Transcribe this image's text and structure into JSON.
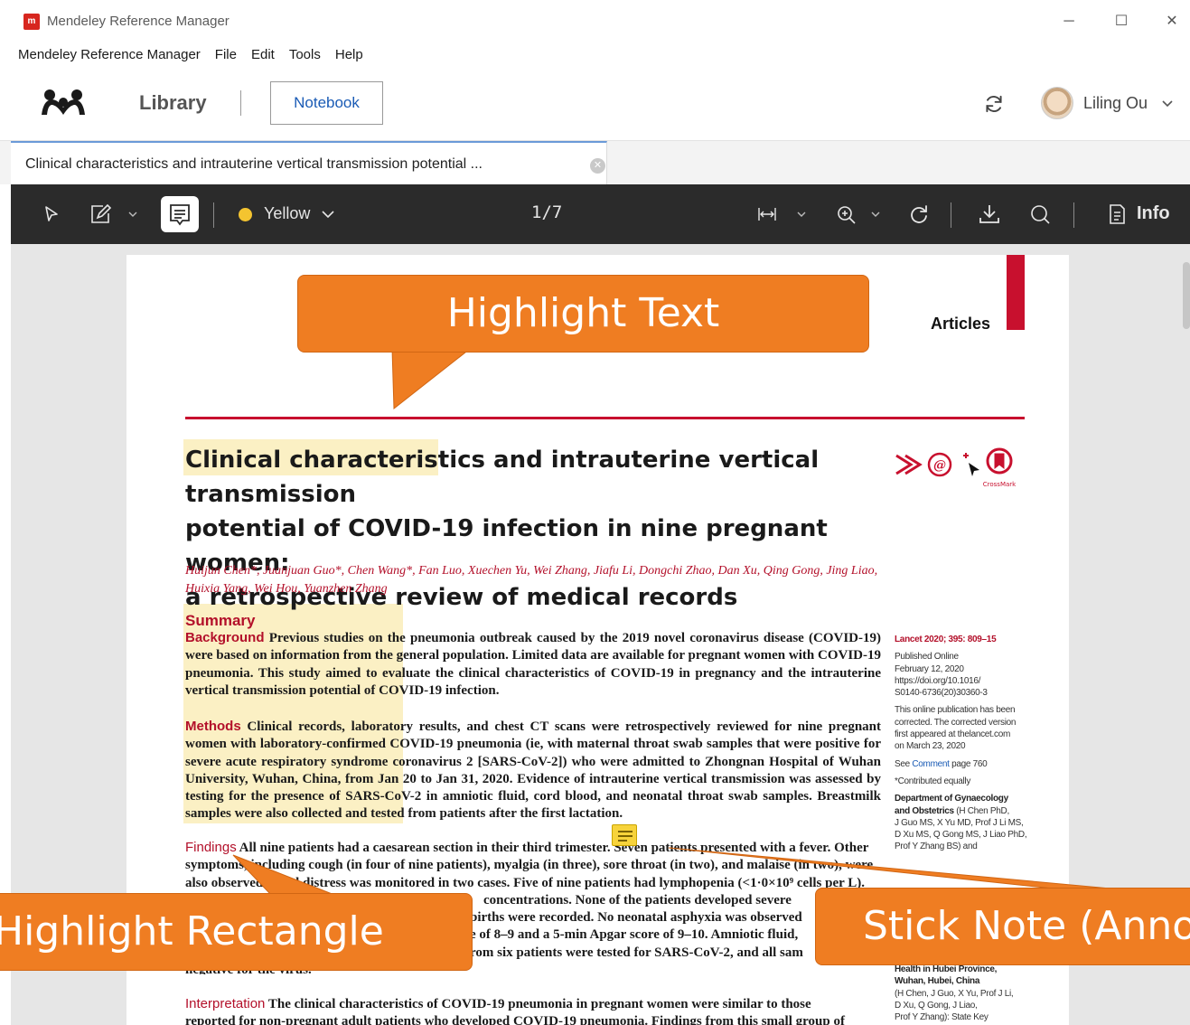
{
  "window": {
    "title": "Mendeley Reference Manager",
    "minimize": "─",
    "maximize": "☐",
    "close": "✕"
  },
  "menu": [
    "Mendeley Reference Manager",
    "File",
    "Edit",
    "Tools",
    "Help"
  ],
  "header": {
    "library_label": "Library",
    "notebook_label": "Notebook",
    "user_name": "Liling Ou"
  },
  "doc_tab": {
    "label": "Clinical characteristics and intrauterine vertical transmission potential ...",
    "close": "✕"
  },
  "toolbar": {
    "color_label": "Yellow",
    "page_indicator": "1/7",
    "info_label": "Info",
    "color_swatch": "#f4c430"
  },
  "paper": {
    "section_label": "Articles",
    "title_highlighted": "Clinical characteristics",
    "title_rest_line1": " and intrauterine vertical transmission",
    "title_line2": "potential of COVID-19 infection in nine pregnant women:",
    "title_line3": "a retrospective review of medical records",
    "badge_caption": "CrossMark",
    "authors": "Huijun Chen*, Juanjuan Guo*, Chen Wang*, Fan Luo, Xuechen Yu, Wei Zhang, Jiafu Li, Dongchi Zhao, Dan Xu, Qing Gong, Jing Liao, Huixia Yang, Wei Hou, Yuanzhen Zhang",
    "summary_heading": "Summary",
    "background_lead": "Background",
    "background_text": " Previous studies on the pneumonia outbreak caused by the 2019 novel coronavirus disease (COVID-19) were based on information from the general population. Limited data are available for pregnant women with COVID-19 pneumonia. This study aimed to evaluate the clinical characteristics of COVID-19 in pregnancy and the intrauterine vertical transmission potential of COVID-19 infection.",
    "methods_lead": "Methods",
    "methods_text": " Clinical records, laboratory results, and chest CT scans were retrospectively reviewed for nine pregnant women with laboratory-confirmed COVID-19 pneumonia (ie, with maternal throat swab samples that were positive for severe acute respiratory syndrome coronavirus 2 [SARS-CoV-2]) who were admitted to Zhongnan Hospital of Wuhan University, Wuhan, China, from Jan 20 to Jan 31, 2020. Evidence of intrauterine vertical transmission was assessed by testing for the presence of SARS-CoV-2 in amniotic fluid, cord blood, and neonatal throat swab samples. Breastmilk samples were also collected and tested from patients after the first lactation.",
    "findings_lead": "Findings",
    "findings_line1": " All nine patients had a caesarean section in their third trimester. Seven patients presented with a fever. Other",
    "findings_line2": "symptoms, including cough (in four of nine patients), myalgia (in three), sore throat (in two), and malaise (in two), were",
    "findings_line3": "also observed. Fetal distress was monitored in two cases. Five of nine patients had lymphopenia (<1·0×10⁹ cells per L).",
    "findings_line4": "concentrations. None of the patients developed severe",
    "findings_line5": "births were recorded. No neonatal asphyxia was observed",
    "findings_line6": "e of 8–9 and a 5-min Apgar score of 9–10. Amniotic fluid,",
    "findings_line7": "rom six patients were tested for SARS-CoV-2, and all sam",
    "findings_line8": "negative for the virus.",
    "interpretation_lead": "Interpretation",
    "interpretation_line1": " The clinical characteristics of COVID-19 pneumonia in pregnant women were similar to those",
    "interpretation_line2": "reported for non-pregnant adult patients who developed COVID-19 pneumonia. Findings from this small group of"
  },
  "sidebar_meta": {
    "citation": "Lancet 2020; 395: 809–15",
    "published_online": "Published Online",
    "pub_date": "February 12, 2020",
    "doi_1": "https://doi.org/10.1016/",
    "doi_2": "S0140-6736(20)30360-3",
    "correction_1": "This online publication has been",
    "correction_2": "corrected. The corrected version",
    "correction_3": "first appeared at thelancet.com",
    "correction_4": "on March 23, 2020",
    "see_prefix": "See ",
    "comment_link": "Comment",
    "comment_suffix": " page 760",
    "contributed": "*Contributed equally",
    "dept_1": "Department of Gynaecology",
    "dept_2": "and Obstetrics",
    "dept_2b": " (H Chen PhD,",
    "dept_3": "J Guo MS, X Yu MD, Prof J Li MS,",
    "dept_4": "D Xu MS, Q Gong MS, J Liao PhD,",
    "dept_5": "Prof Y Zhang BS) and",
    "aff_1": "Health in Hubei Province,",
    "aff_2": "Wuhan, Hubei, China",
    "aff_3": "(H Chen, J Guo, X Yu, Prof J Li,",
    "aff_4": "D Xu, Q Gong, J Liao,",
    "aff_5": "Prof Y Zhang): State Key"
  },
  "callouts": {
    "highlight_text": "Highlight Text",
    "highlight_rectangle": "Highlight Rectangle",
    "sticky_note": "Stick Note (Anno"
  },
  "colors": {
    "accent_red": "#c8102e",
    "callout_orange": "#ef7d22",
    "highlight_yellow": "#fbf0c4",
    "toolbar_dark": "#2b2b2b"
  },
  "icons": [
    "app-icon",
    "mendeley-logo",
    "sync-icon",
    "chevron-down-icon",
    "select-pointer-icon",
    "draw-shape-icon",
    "note-comment-icon",
    "fit-width-icon",
    "zoom-in-icon",
    "rotate-icon",
    "download-icon",
    "search-icon",
    "info-icon",
    "close-icon",
    "sticky-note-icon"
  ]
}
